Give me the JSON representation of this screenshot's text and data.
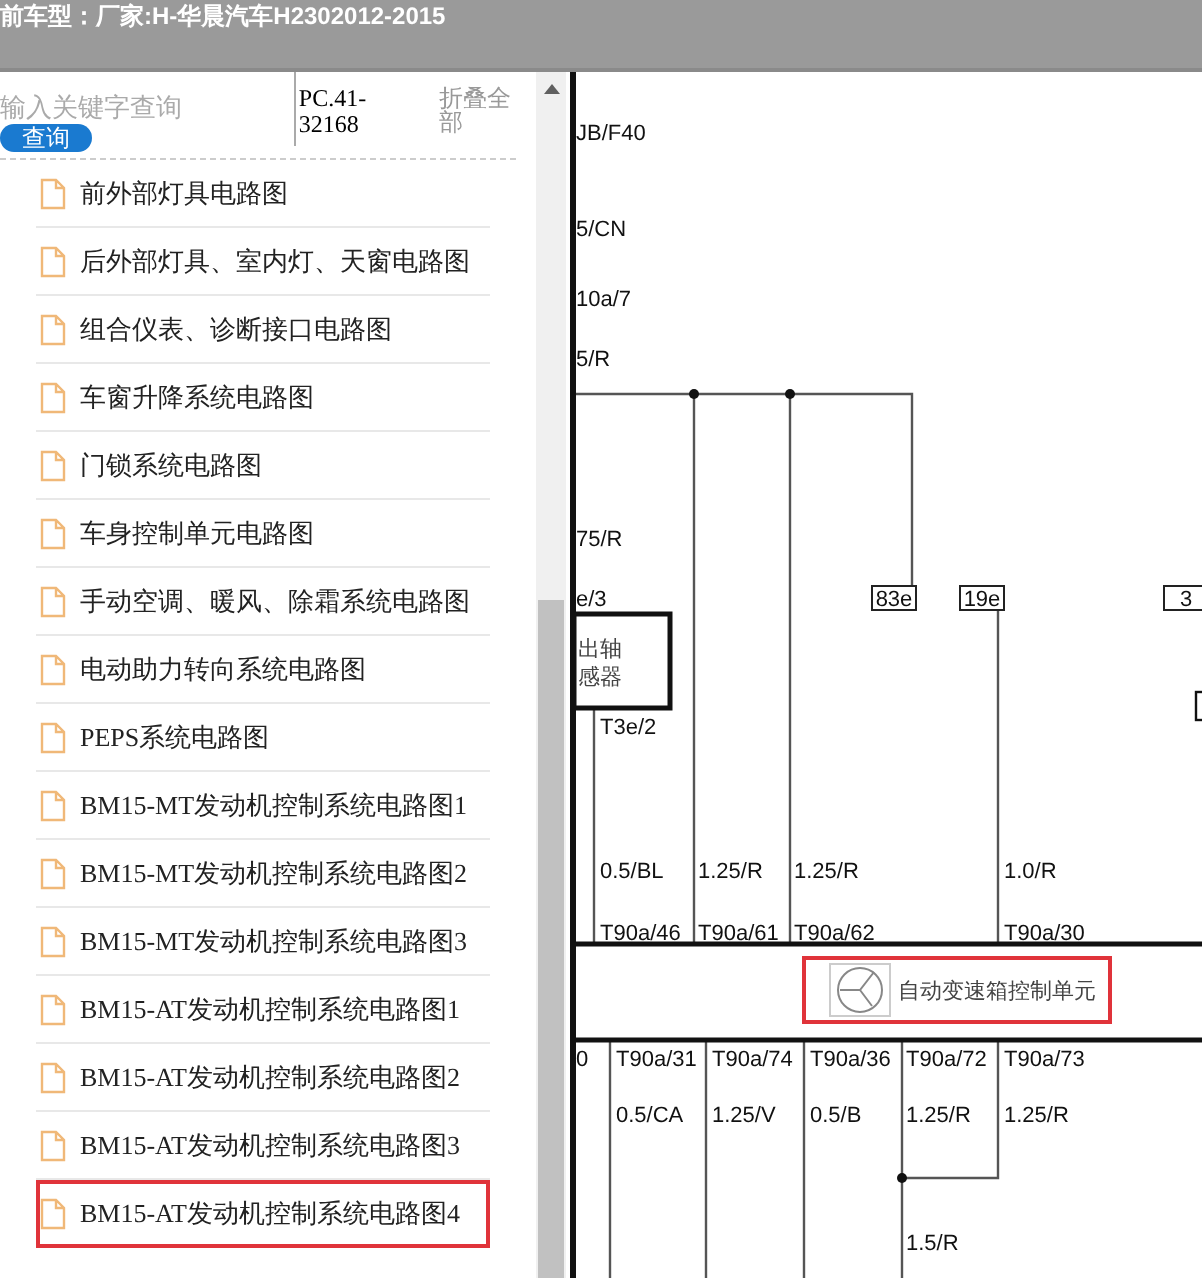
{
  "header": {
    "title": "前车型：厂家:H-华晨汽车H2302012-2015"
  },
  "search": {
    "placeholder": "输入关键字查询",
    "button": "查询"
  },
  "code": "PC.41-32168",
  "collapse": "折叠全部",
  "items": [
    {
      "label": "前外部灯具电路图",
      "selected": false
    },
    {
      "label": "后外部灯具、室内灯、天窗电路图",
      "selected": false
    },
    {
      "label": "组合仪表、诊断接口电路图",
      "selected": false
    },
    {
      "label": "车窗升降系统电路图",
      "selected": false
    },
    {
      "label": "门锁系统电路图",
      "selected": false
    },
    {
      "label": "车身控制单元电路图",
      "selected": false
    },
    {
      "label": "手动空调、暖风、除霜系统电路图",
      "selected": false
    },
    {
      "label": "电动助力转向系统电路图",
      "selected": false
    },
    {
      "label": "PEPS系统电路图",
      "selected": false
    },
    {
      "label": "BM15-MT发动机控制系统电路图1",
      "selected": false
    },
    {
      "label": "BM15-MT发动机控制系统电路图2",
      "selected": false
    },
    {
      "label": "BM15-MT发动机控制系统电路图3",
      "selected": false
    },
    {
      "label": "BM15-AT发动机控制系统电路图1",
      "selected": false
    },
    {
      "label": "BM15-AT发动机控制系统电路图2",
      "selected": false
    },
    {
      "label": "BM15-AT发动机控制系统电路图3",
      "selected": false
    },
    {
      "label": "BM15-AT发动机控制系统电路图4",
      "selected": true
    }
  ],
  "diagram": {
    "labels": [
      "JB/F40",
      "5/CN",
      "10a/7",
      "5/R",
      "75/R",
      "e/3",
      "T3e/2",
      "0.5/BL",
      "1.25/R",
      "1.25/R",
      "1.0/R",
      "T90a/46",
      "T90a/61",
      "T90a/62",
      "T90a/30",
      "0",
      "T90a/31",
      "T90a/74",
      "T90a/36",
      "T90a/72",
      "T90a/73",
      "0.5/CA",
      "1.25/V",
      "0.5/B",
      "1.25/R",
      "1.25/R",
      "1.5/R"
    ],
    "pins": [
      "83e",
      "19e",
      "3"
    ],
    "sensor": [
      "出轴",
      "感器"
    ],
    "unit": "自动变速箱控制单元"
  }
}
